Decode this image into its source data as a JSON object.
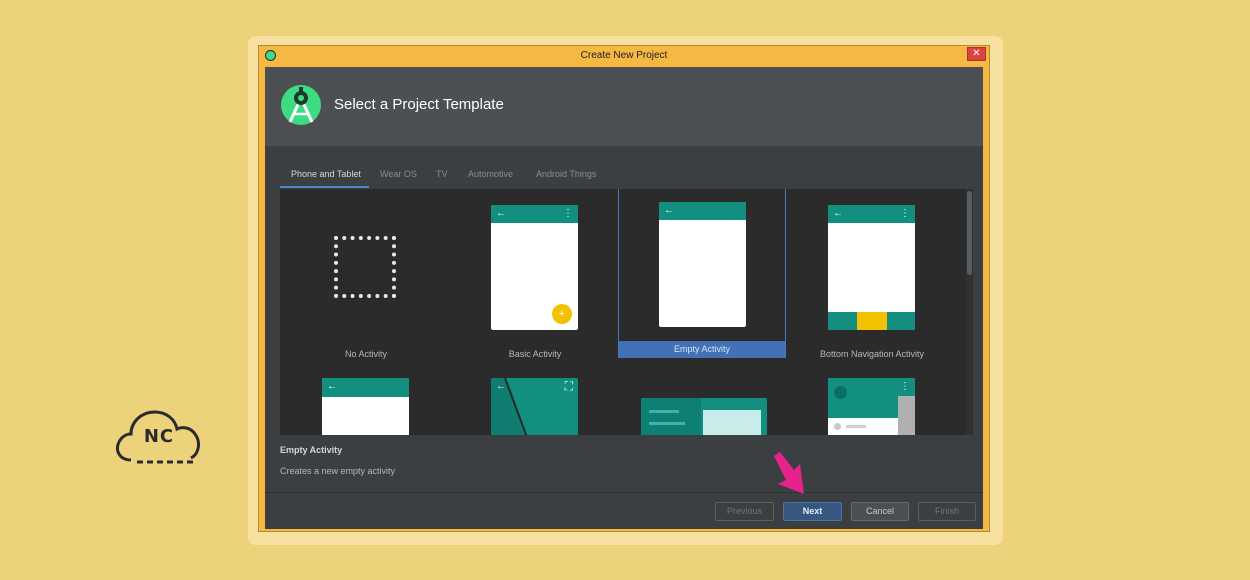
{
  "window": {
    "title": "Create New Project",
    "close_label": "✕",
    "header_title": "Select a Project Template"
  },
  "tabs": [
    "Phone and Tablet",
    "Wear OS",
    "TV",
    "Automotive",
    "Android Things"
  ],
  "active_tab": "Phone and Tablet",
  "templates": [
    {
      "label": "No Activity"
    },
    {
      "label": "Basic Activity"
    },
    {
      "label": "Empty Activity",
      "selected": true
    },
    {
      "label": "Bottom Navigation Activity"
    }
  ],
  "description": {
    "title": "Empty Activity",
    "text": "Creates a new empty activity"
  },
  "buttons": {
    "previous": "Previous",
    "next": "Next",
    "cancel": "Cancel",
    "finish": "Finish"
  },
  "icons": {
    "back": "←",
    "menu": "⋮",
    "fab": "+",
    "expand": "⛶"
  },
  "logo": {
    "text": "NC"
  },
  "colors": {
    "background": "#ecd27a",
    "teal": "#138f80",
    "accent_yellow": "#f2c200",
    "selection": "#4272b5",
    "pointer_arrow": "#e8228c"
  }
}
